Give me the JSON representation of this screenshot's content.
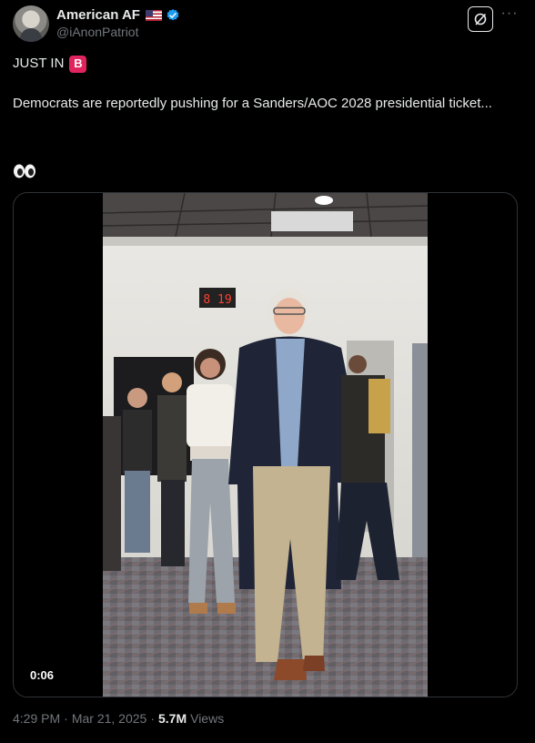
{
  "author": {
    "display_name": "American AF",
    "handle": "@iAnonPatriot",
    "flag_icon": "us-flag-icon",
    "verified_color": "#1d9bf0"
  },
  "tweet": {
    "line1_text": "JUST IN",
    "badge_letter": "B",
    "body": "Democrats are reportedly pushing for a Sanders/AOC 2028 presidential ticket...",
    "emoji_icon": "eyes-emoji-icon"
  },
  "video": {
    "duration": "0:06",
    "wall_clock": "8 19"
  },
  "meta": {
    "time": "4:29 PM",
    "date": "Mar 21, 2025",
    "views_count": "5.7M",
    "views_label": "Views"
  },
  "colors": {
    "background": "#000000",
    "text_primary": "#e7e9ea",
    "text_secondary": "#71767b",
    "badge_red": "#e0245e"
  }
}
